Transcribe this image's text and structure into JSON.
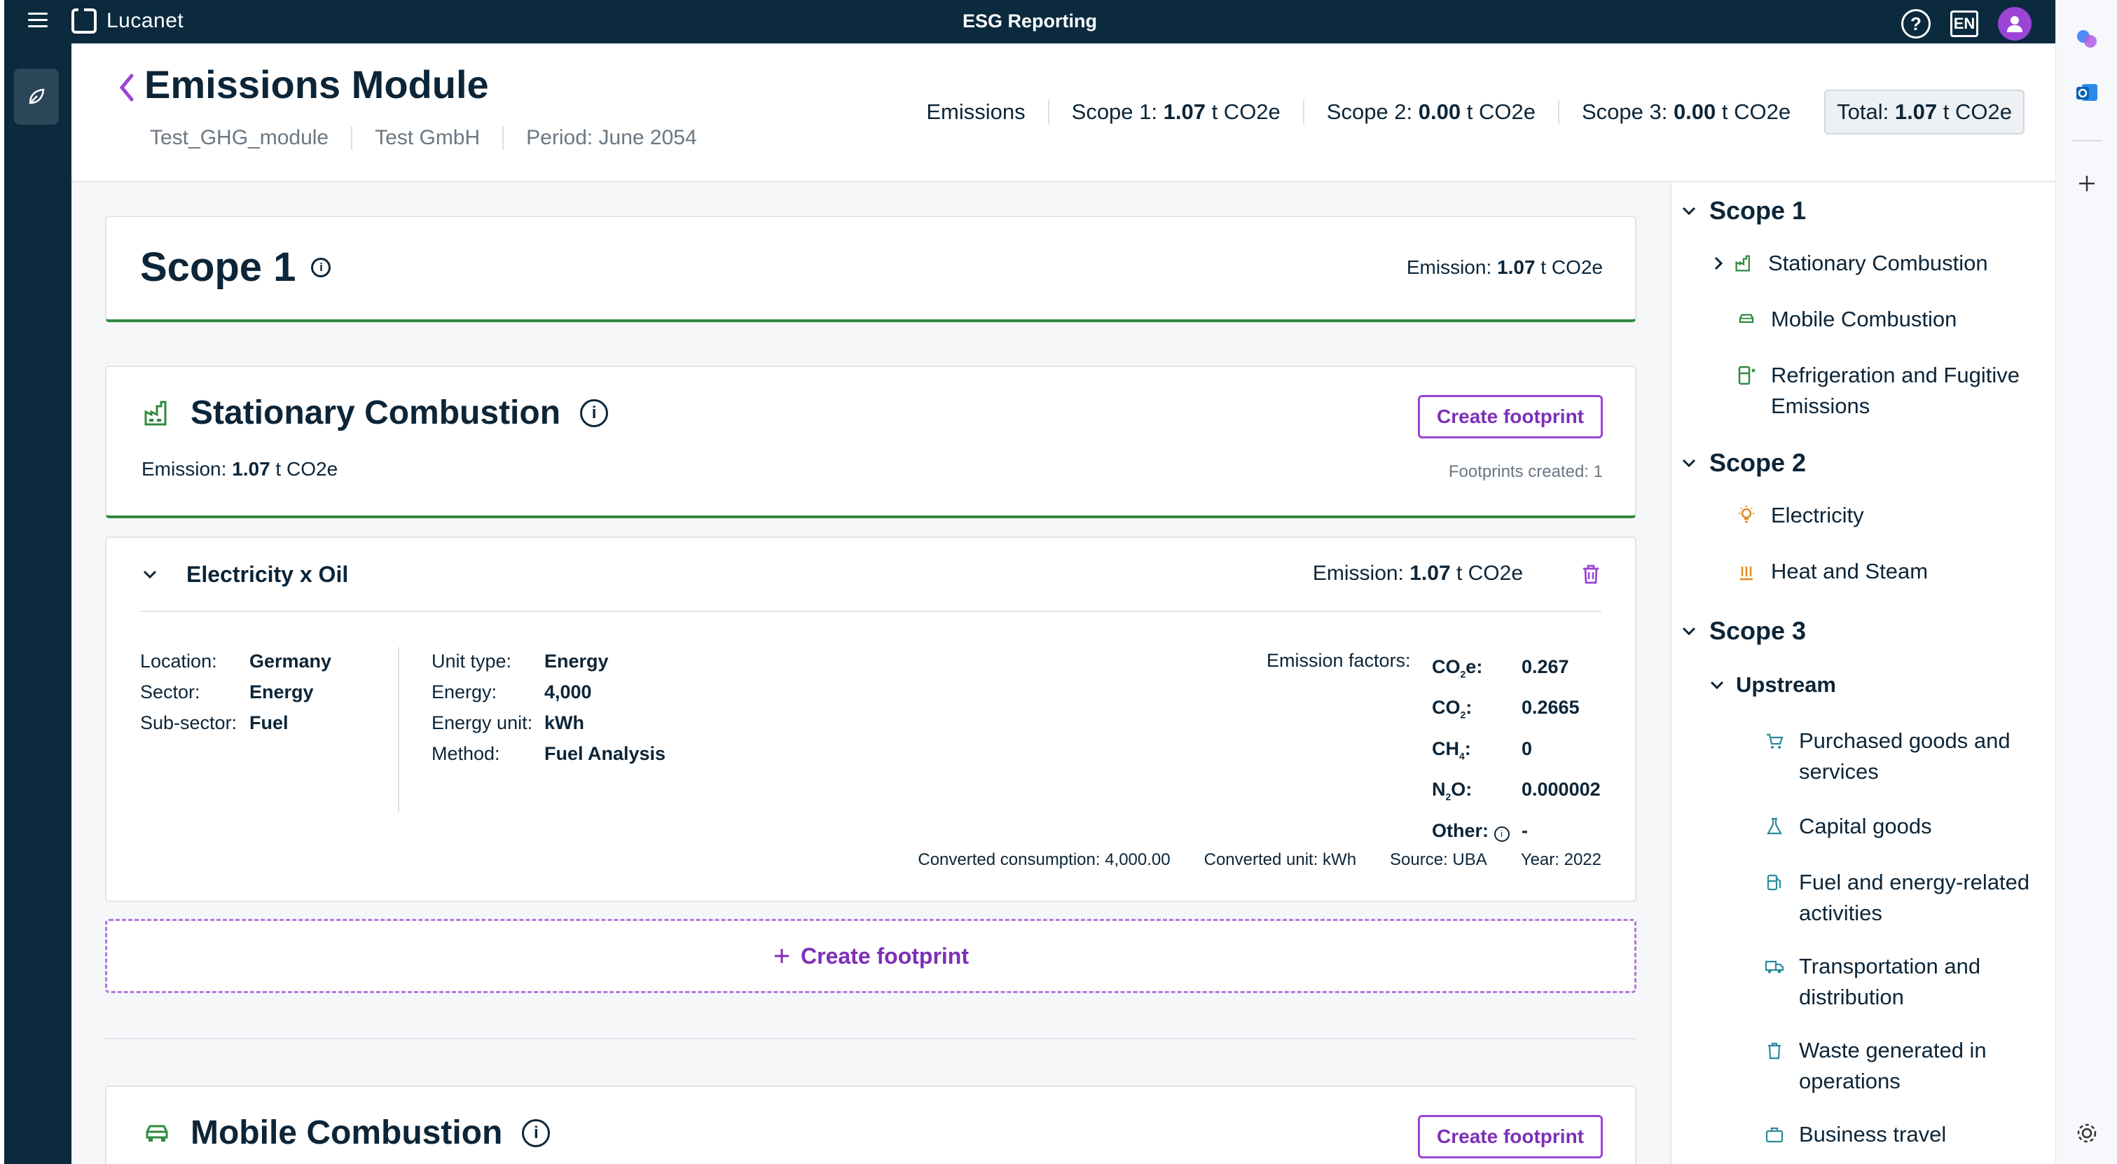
{
  "app": {
    "title": "ESG Reporting",
    "logo_text": "Lucanet",
    "lang": "EN",
    "help": "?"
  },
  "header": {
    "title": "Emissions Module",
    "meta": [
      "Test_GHG_module",
      "Test GmbH",
      "Period: June 2054"
    ],
    "summary_label": "Emissions",
    "scope1_label": "Scope 1: ",
    "scope1_value": "1.07",
    "scope1_unit": " t CO2e",
    "scope2_label": "Scope 2: ",
    "scope2_value": "0.00",
    "scope2_unit": " t CO2e",
    "scope3_label": "Scope 3: ",
    "scope3_value": "0.00",
    "scope3_unit": " t CO2e",
    "total_label": "Total: ",
    "total_value": "1.07",
    "total_unit": " t CO2e"
  },
  "scope1_card": {
    "title": "Scope 1",
    "info": "i",
    "emission_label": "Emission: ",
    "emission_value": "1.07",
    "emission_unit": " t CO2e"
  },
  "stationary": {
    "title": "Stationary Combustion",
    "info": "i",
    "create_label": "Create footprint",
    "emission_label": "Emission: ",
    "emission_value": "1.07",
    "emission_unit": " t CO2e",
    "footprints_created": "Footprints created: 1"
  },
  "footprint": {
    "title": "Electricity x Oil",
    "emission_label": "Emission: ",
    "emission_value": "1.07",
    "emission_unit": " t CO2e",
    "col1": [
      {
        "k": "Location:",
        "v": "Germany"
      },
      {
        "k": "Sector:",
        "v": "Energy"
      },
      {
        "k": "Sub-sector:",
        "v": "Fuel"
      }
    ],
    "col2": [
      {
        "k": "Unit type:",
        "v": "Energy"
      },
      {
        "k": "Energy:",
        "v": "4,000"
      },
      {
        "k": "Energy unit:",
        "v": "kWh"
      },
      {
        "k": "Method:",
        "v": "Fuel Analysis"
      }
    ],
    "ef_label": "Emission factors:",
    "ef": {
      "co2e": "0.267",
      "co2": "0.2665",
      "ch4": "0",
      "n2o": "0.000002",
      "other": "-",
      "co2e_k1": "CO",
      "co2e_sub": "2",
      "co2e_k2": "e:",
      "co2_k1": "CO",
      "co2_sub": "2",
      "co2_k2": ":",
      "ch4_k1": "CH",
      "ch4_sub": "4",
      "ch4_k2": ":",
      "n2o_k1": "N",
      "n2o_sub": "2",
      "n2o_k2": "O:",
      "other_k": "Other:",
      "other_info": "i"
    },
    "converted_consumption": "Converted consumption: 4,000.00",
    "converted_unit": "Converted unit: kWh",
    "source": "Source: UBA",
    "year": "Year: 2022"
  },
  "create_footprint_dashed": "Create footprint",
  "mobile": {
    "title": "Mobile Combustion",
    "info": "i",
    "create_label": "Create footprint"
  },
  "nav": {
    "scope1": "Scope 1",
    "scope1_items": [
      "Stationary Combustion",
      "Mobile Combustion",
      "Refrigeration and Fugitive Emissions"
    ],
    "scope2": "Scope 2",
    "scope2_items": [
      "Electricity",
      "Heat and Steam"
    ],
    "scope3": "Scope 3",
    "upstream": "Upstream",
    "upstream_items": [
      "Purchased goods and services",
      "Capital goods",
      "Fuel and energy-related activities",
      "Transportation and distribution",
      "Waste generated in operations",
      "Business travel"
    ]
  },
  "colors": {
    "navy": "#0b2a3e",
    "purple": "#9b45d6",
    "green": "#2f8a3f",
    "orange": "#e08a1e"
  }
}
